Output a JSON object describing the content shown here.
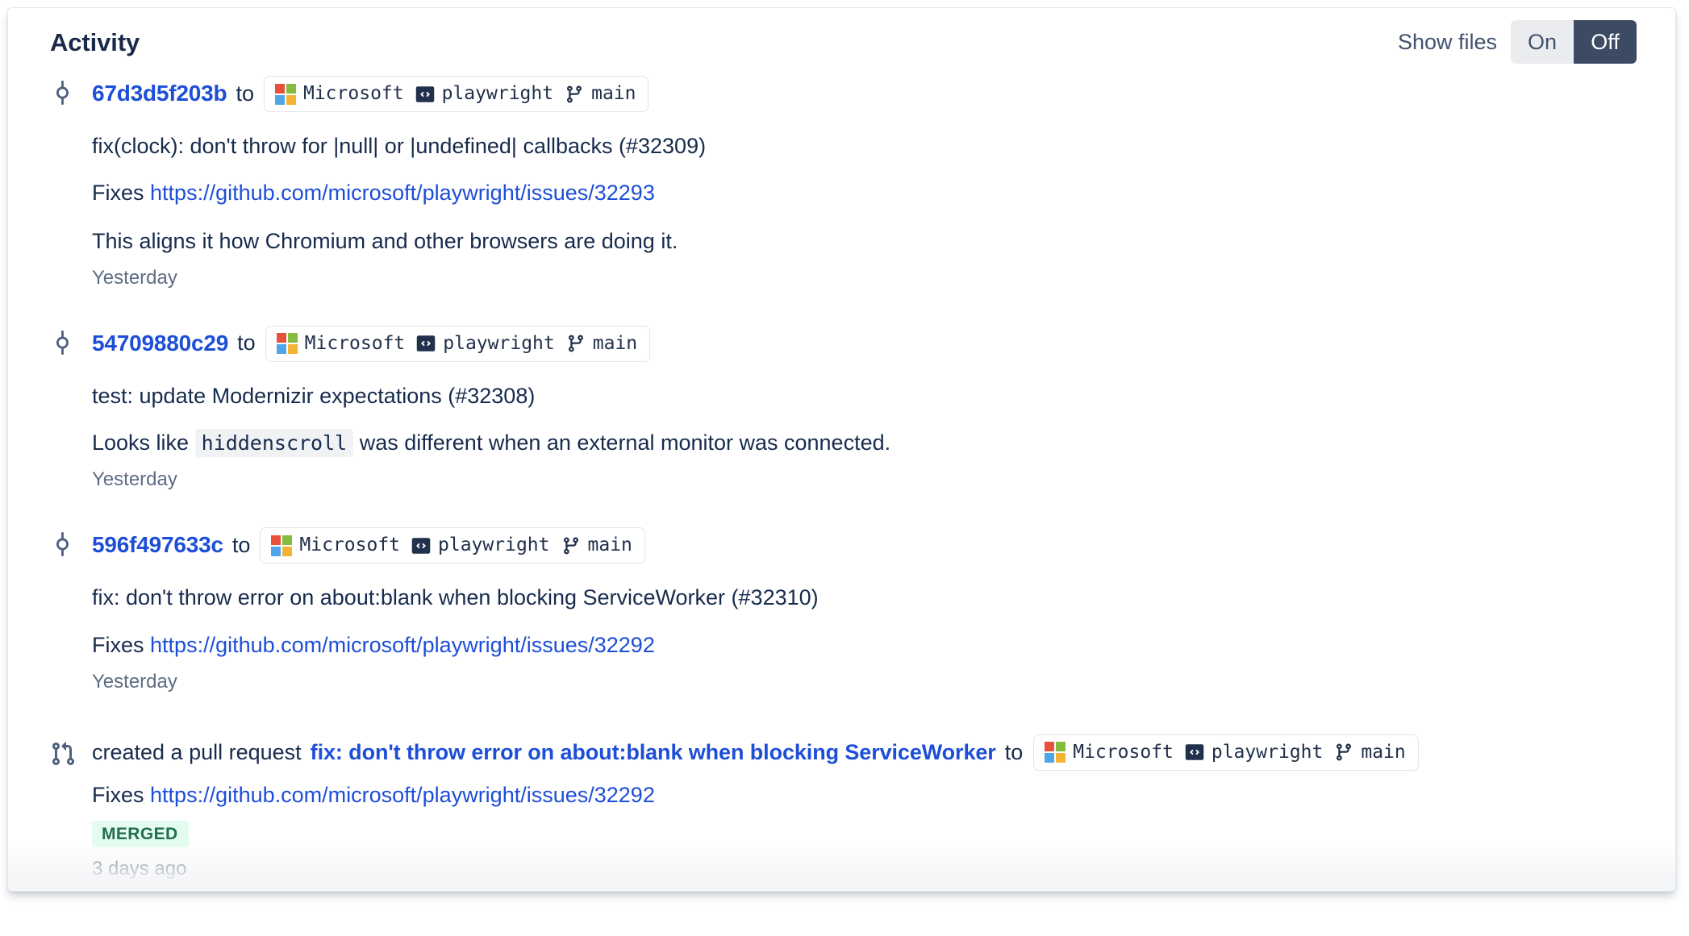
{
  "header": {
    "title": "Activity",
    "show_files_label": "Show files",
    "toggle": {
      "on_label": "On",
      "off_label": "Off",
      "selected": "Off"
    }
  },
  "labels": {
    "to": "to",
    "created_pull_request": "created a pull request",
    "fixes": "Fixes"
  },
  "repo": {
    "owner": "Microsoft",
    "name": "playwright",
    "branch": "main"
  },
  "colors": {
    "link": "#1d4ed8",
    "text": "#172b4d",
    "muted": "#5e6c84",
    "toggle_active_bg": "#3c4a63",
    "toggle_inactive_bg": "#ebecf0",
    "badge_bg": "#e3fcef",
    "badge_text": "#216e4e",
    "ms_red": "#e8513a",
    "ms_green": "#84bc3d",
    "ms_blue": "#4fa6e8",
    "ms_yellow": "#f5b335"
  },
  "entries": [
    {
      "kind": "commit",
      "icon": "git-commit-icon",
      "hash": "67d3d5f203b",
      "title": "fix(clock): don't throw for |null| or |undefined| callbacks (#32309)",
      "fixes_url": "https://github.com/microsoft/playwright/issues/32293",
      "body": "This aligns it how Chromium and other browsers are doing it.",
      "timestamp": "Yesterday"
    },
    {
      "kind": "commit",
      "icon": "git-commit-icon",
      "hash": "54709880c29",
      "title": "test: update Modernizir expectations (#32308)",
      "body_before_code": "Looks like",
      "body_code": "hiddenscroll",
      "body_after_code": "was different when an external monitor was connected.",
      "timestamp": "Yesterday"
    },
    {
      "kind": "commit",
      "icon": "git-commit-icon",
      "hash": "596f497633c",
      "title": "fix: don't throw error on about:blank when blocking ServiceWorker (#32310)",
      "fixes_url": "https://github.com/microsoft/playwright/issues/32292",
      "timestamp": "Yesterday"
    },
    {
      "kind": "pull-request",
      "icon": "git-pull-request-icon",
      "pr_title": "fix: don't throw error on about:blank when blocking ServiceWorker",
      "fixes_url": "https://github.com/microsoft/playwright/issues/32292",
      "status_badge": "MERGED",
      "timestamp": "3 days ago"
    }
  ]
}
